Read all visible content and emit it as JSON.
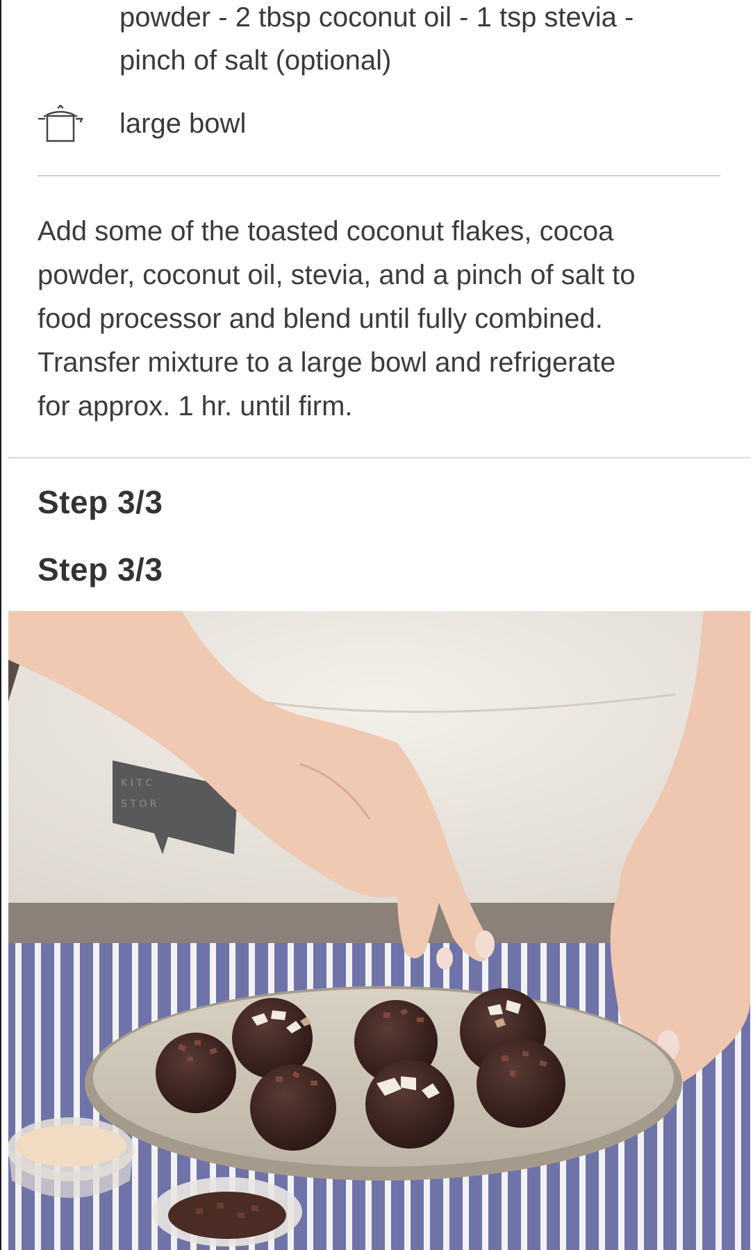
{
  "ingredients": {
    "text_line_1": "powder - 2 tbsp coconut oil - 1 tsp stevia -",
    "text_line_2": "pinch of salt (optional)"
  },
  "utensils": {
    "icon": "pot-icon",
    "label": "large bowl"
  },
  "instruction": {
    "line_1": "Add some of the toasted coconut flakes, cocoa",
    "line_2": "powder, coconut oil, stevia, and a pinch of salt to",
    "line_3": "food processor and blend until fully combined.",
    "line_4": "Transfer mixture to a large bowl and refrigerate",
    "line_5": "for approx. 1 hr. until firm."
  },
  "steps": {
    "label_1": "Step 3/3",
    "label_2": "Step 3/3"
  },
  "photo": {
    "subject": "hands sprinkling toppings on chocolate coconut balls on an oval plate"
  },
  "colors": {
    "text": "#3b3b3b",
    "divider": "#cfcfcf",
    "tablecloth_stripe": "#6f73a8"
  }
}
